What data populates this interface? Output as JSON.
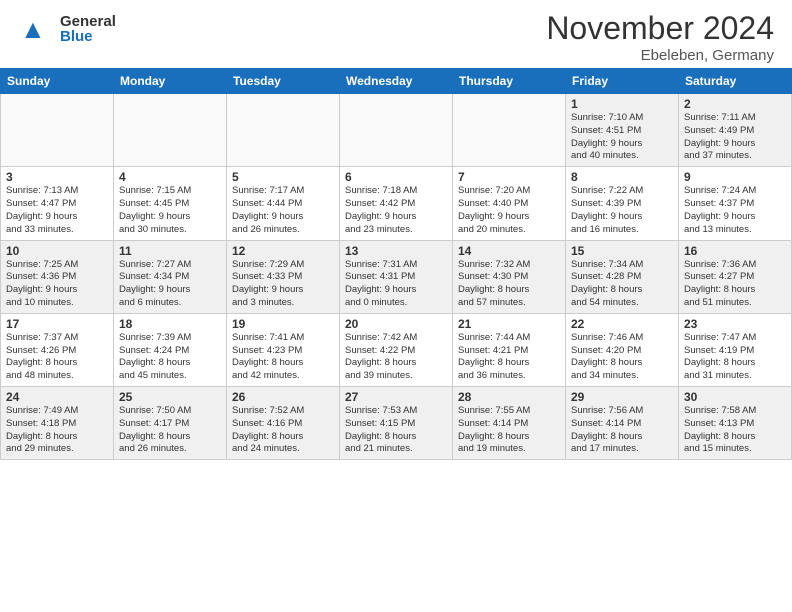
{
  "header": {
    "logo_general": "General",
    "logo_blue": "Blue",
    "month_title": "November 2024",
    "location": "Ebeleben, Germany"
  },
  "weekdays": [
    "Sunday",
    "Monday",
    "Tuesday",
    "Wednesday",
    "Thursday",
    "Friday",
    "Saturday"
  ],
  "weeks": [
    [
      {
        "day": "",
        "info": ""
      },
      {
        "day": "",
        "info": ""
      },
      {
        "day": "",
        "info": ""
      },
      {
        "day": "",
        "info": ""
      },
      {
        "day": "",
        "info": ""
      },
      {
        "day": "1",
        "info": "Sunrise: 7:10 AM\nSunset: 4:51 PM\nDaylight: 9 hours\nand 40 minutes."
      },
      {
        "day": "2",
        "info": "Sunrise: 7:11 AM\nSunset: 4:49 PM\nDaylight: 9 hours\nand 37 minutes."
      }
    ],
    [
      {
        "day": "3",
        "info": "Sunrise: 7:13 AM\nSunset: 4:47 PM\nDaylight: 9 hours\nand 33 minutes."
      },
      {
        "day": "4",
        "info": "Sunrise: 7:15 AM\nSunset: 4:45 PM\nDaylight: 9 hours\nand 30 minutes."
      },
      {
        "day": "5",
        "info": "Sunrise: 7:17 AM\nSunset: 4:44 PM\nDaylight: 9 hours\nand 26 minutes."
      },
      {
        "day": "6",
        "info": "Sunrise: 7:18 AM\nSunset: 4:42 PM\nDaylight: 9 hours\nand 23 minutes."
      },
      {
        "day": "7",
        "info": "Sunrise: 7:20 AM\nSunset: 4:40 PM\nDaylight: 9 hours\nand 20 minutes."
      },
      {
        "day": "8",
        "info": "Sunrise: 7:22 AM\nSunset: 4:39 PM\nDaylight: 9 hours\nand 16 minutes."
      },
      {
        "day": "9",
        "info": "Sunrise: 7:24 AM\nSunset: 4:37 PM\nDaylight: 9 hours\nand 13 minutes."
      }
    ],
    [
      {
        "day": "10",
        "info": "Sunrise: 7:25 AM\nSunset: 4:36 PM\nDaylight: 9 hours\nand 10 minutes."
      },
      {
        "day": "11",
        "info": "Sunrise: 7:27 AM\nSunset: 4:34 PM\nDaylight: 9 hours\nand 6 minutes."
      },
      {
        "day": "12",
        "info": "Sunrise: 7:29 AM\nSunset: 4:33 PM\nDaylight: 9 hours\nand 3 minutes."
      },
      {
        "day": "13",
        "info": "Sunrise: 7:31 AM\nSunset: 4:31 PM\nDaylight: 9 hours\nand 0 minutes."
      },
      {
        "day": "14",
        "info": "Sunrise: 7:32 AM\nSunset: 4:30 PM\nDaylight: 8 hours\nand 57 minutes."
      },
      {
        "day": "15",
        "info": "Sunrise: 7:34 AM\nSunset: 4:28 PM\nDaylight: 8 hours\nand 54 minutes."
      },
      {
        "day": "16",
        "info": "Sunrise: 7:36 AM\nSunset: 4:27 PM\nDaylight: 8 hours\nand 51 minutes."
      }
    ],
    [
      {
        "day": "17",
        "info": "Sunrise: 7:37 AM\nSunset: 4:26 PM\nDaylight: 8 hours\nand 48 minutes."
      },
      {
        "day": "18",
        "info": "Sunrise: 7:39 AM\nSunset: 4:24 PM\nDaylight: 8 hours\nand 45 minutes."
      },
      {
        "day": "19",
        "info": "Sunrise: 7:41 AM\nSunset: 4:23 PM\nDaylight: 8 hours\nand 42 minutes."
      },
      {
        "day": "20",
        "info": "Sunrise: 7:42 AM\nSunset: 4:22 PM\nDaylight: 8 hours\nand 39 minutes."
      },
      {
        "day": "21",
        "info": "Sunrise: 7:44 AM\nSunset: 4:21 PM\nDaylight: 8 hours\nand 36 minutes."
      },
      {
        "day": "22",
        "info": "Sunrise: 7:46 AM\nSunset: 4:20 PM\nDaylight: 8 hours\nand 34 minutes."
      },
      {
        "day": "23",
        "info": "Sunrise: 7:47 AM\nSunset: 4:19 PM\nDaylight: 8 hours\nand 31 minutes."
      }
    ],
    [
      {
        "day": "24",
        "info": "Sunrise: 7:49 AM\nSunset: 4:18 PM\nDaylight: 8 hours\nand 29 minutes."
      },
      {
        "day": "25",
        "info": "Sunrise: 7:50 AM\nSunset: 4:17 PM\nDaylight: 8 hours\nand 26 minutes."
      },
      {
        "day": "26",
        "info": "Sunrise: 7:52 AM\nSunset: 4:16 PM\nDaylight: 8 hours\nand 24 minutes."
      },
      {
        "day": "27",
        "info": "Sunrise: 7:53 AM\nSunset: 4:15 PM\nDaylight: 8 hours\nand 21 minutes."
      },
      {
        "day": "28",
        "info": "Sunrise: 7:55 AM\nSunset: 4:14 PM\nDaylight: 8 hours\nand 19 minutes."
      },
      {
        "day": "29",
        "info": "Sunrise: 7:56 AM\nSunset: 4:14 PM\nDaylight: 8 hours\nand 17 minutes."
      },
      {
        "day": "30",
        "info": "Sunrise: 7:58 AM\nSunset: 4:13 PM\nDaylight: 8 hours\nand 15 minutes."
      }
    ]
  ]
}
